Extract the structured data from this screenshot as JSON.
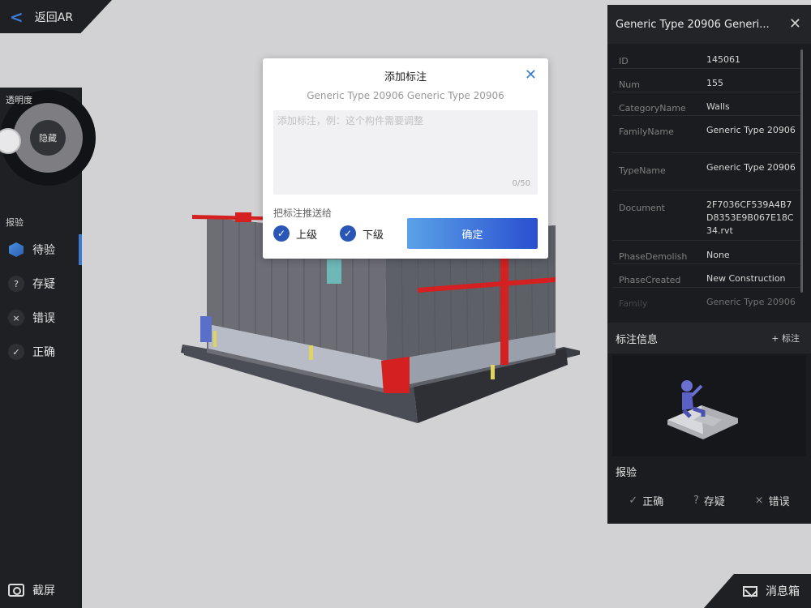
{
  "back_label": "返回AR",
  "opacity": {
    "label": "透明度",
    "center_label": "隐藏"
  },
  "sidebar": {
    "section_title": "报验",
    "items": [
      {
        "label": "待验",
        "icon": "cube-icon",
        "active": true
      },
      {
        "label": "存疑",
        "icon": "question-icon",
        "symbol": "?"
      },
      {
        "label": "错误",
        "icon": "cross-icon",
        "symbol": "×"
      },
      {
        "label": "正确",
        "icon": "check-icon",
        "symbol": "✓"
      }
    ],
    "screenshot_label": "截屏"
  },
  "dialog": {
    "title": "添加标注",
    "close_symbol": "✕",
    "subtitle": "Generic Type 20906 Generic Type 20906",
    "placeholder": "添加标注，例：这个构件需要调整",
    "counter": "0/50",
    "push_label": "把标注推送给",
    "options": [
      {
        "label": "上级",
        "checked": true
      },
      {
        "label": "下级",
        "checked": true
      }
    ],
    "confirm_label": "确定"
  },
  "properties": {
    "header": "Generic Type 20906 Generi...",
    "close_symbol": "✕",
    "rows": [
      {
        "key": "ID",
        "value": "145061"
      },
      {
        "key": "Num",
        "value": "155"
      },
      {
        "key": "CategoryName",
        "value": "Walls"
      },
      {
        "key": "FamilyName",
        "value": "Generic Type 20906"
      },
      {
        "key": "TypeName",
        "value": "Generic Type 20906"
      },
      {
        "key": "Document",
        "value": "2F7036CF539A4B7D8353E9B067E18C34.rvt"
      },
      {
        "key": "PhaseDemolish",
        "value": "None"
      },
      {
        "key": "PhaseCreated",
        "value": "New Construction"
      },
      {
        "key": "Family",
        "value": "Generic Type 20906"
      }
    ]
  },
  "annotation": {
    "title": "标注信息",
    "add_label": "+ 标注"
  },
  "inspection": {
    "title": "报验",
    "options": [
      {
        "label": "正确",
        "symbol": "✓"
      },
      {
        "label": "存疑",
        "symbol": "?"
      },
      {
        "label": "错误",
        "symbol": "×"
      }
    ]
  },
  "message_box_label": "消息箱"
}
